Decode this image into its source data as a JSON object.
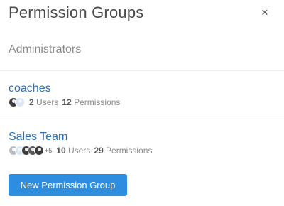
{
  "header": {
    "title": "Permission Groups",
    "close_icon": "close-icon",
    "close_glyph": "×"
  },
  "admin": {
    "label": "Administrators"
  },
  "groups": [
    {
      "name": "coaches",
      "users_count": "2",
      "users_label": "Users",
      "permissions_count": "12",
      "permissions_label": "Permissions",
      "avatar_extra": ""
    },
    {
      "name": "Sales Team",
      "users_count": "10",
      "users_label": "Users",
      "permissions_count": "29",
      "permissions_label": "Permissions",
      "avatar_extra": "+5"
    }
  ],
  "actions": {
    "new_group_label": "New Permission Group"
  },
  "colors": {
    "link": "#2a6fb5",
    "button": "#2d8ee0"
  }
}
